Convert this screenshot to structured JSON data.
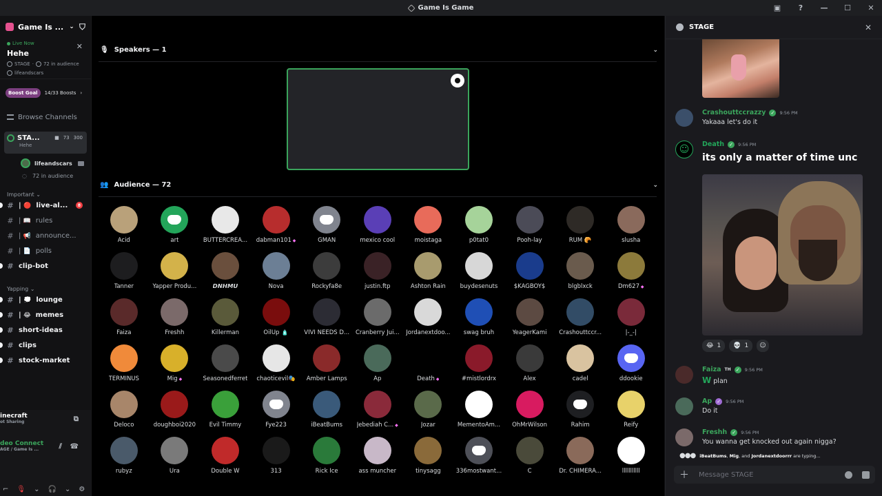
{
  "window": {
    "title": "Game Is Game"
  },
  "sidebar": {
    "server_name": "Game Is ...",
    "live": {
      "badge": "Live Now",
      "title": "Hehe",
      "meta_stage": "STAGE",
      "meta_audience": "72 in audience",
      "host": "lifeandscars"
    },
    "boost": {
      "tag": "Boost Goal",
      "count": "14/33 Boosts"
    },
    "browse": "Browse Channels",
    "stage_channel": {
      "name": "STA...",
      "topic": "Hehe",
      "video_count": "73",
      "limit": "300",
      "speaker": "lifeandscars",
      "audience": "72 in audience"
    },
    "categories": [
      {
        "label": "Important",
        "channels": [
          {
            "name": "live-al...",
            "emoji": "🔴",
            "badge": "8",
            "bright": true
          },
          {
            "name": "rules",
            "emoji": "📖",
            "bright": false
          },
          {
            "name": "announce...",
            "emoji": "📢",
            "bright": false
          },
          {
            "name": "polls",
            "emoji": "📄",
            "bright": false
          },
          {
            "name": "clip-bot",
            "emoji": "",
            "bright": true
          }
        ]
      },
      {
        "label": "Yapping",
        "channels": [
          {
            "name": "lounge",
            "emoji": "💭",
            "bright": true
          },
          {
            "name": "memes",
            "emoji": "😂",
            "bright": true
          },
          {
            "name": "short-ideas",
            "emoji": "",
            "bright": true
          },
          {
            "name": "clips",
            "emoji": "",
            "bright": true
          },
          {
            "name": "stock-market",
            "emoji": "",
            "bright": true
          }
        ]
      }
    ],
    "activity": {
      "game": "inecraft",
      "game_sub": "ot Sharing",
      "voice": "deo Connect",
      "voice_sub": "AGE / Game Is ..."
    }
  },
  "stage": {
    "speakers_header": "Speakers — 1",
    "audience_header": "Audience — 72",
    "audience": [
      {
        "name": "Acid",
        "color": "#b9a17a"
      },
      {
        "name": "art",
        "color": "#23a55a",
        "discord": true
      },
      {
        "name": "BUTTERCREA...",
        "color": "#e8e8e8"
      },
      {
        "name": "dabman101",
        "color": "#b72d2d",
        "boost": true
      },
      {
        "name": "GMAN",
        "color": "#80848e",
        "discord": true
      },
      {
        "name": "mexico cool",
        "color": "#5a3fb6"
      },
      {
        "name": "moistaga",
        "color": "#e86b5a"
      },
      {
        "name": "p0tat0",
        "color": "#a6d39a"
      },
      {
        "name": "Pooh-lay",
        "color": "#4b4b57"
      },
      {
        "name": "RUM 🥐",
        "color": "#2e2a26"
      },
      {
        "name": "slusha",
        "color": "#8a6a5c"
      },
      {
        "name": "Tanner",
        "color": "#1d1d1f"
      },
      {
        "name": "Yapper Produ...",
        "color": "#d3b24a"
      },
      {
        "name": "𝘿𝙉𝙃𝙈𝙐",
        "color": "#6a4f3d"
      },
      {
        "name": "Nova",
        "color": "#6c7f95"
      },
      {
        "name": "Rockyfa8e",
        "color": "#3c3c3c"
      },
      {
        "name": "justin.ftp",
        "color": "#3a2226"
      },
      {
        "name": "Ashton Rain",
        "color": "#a89b6e"
      },
      {
        "name": "buydesenuts",
        "color": "#d7d7d7"
      },
      {
        "name": "$KAGBOY$",
        "color": "#1a3c8c"
      },
      {
        "name": "blgblxck",
        "color": "#6a5b4d"
      },
      {
        "name": "Dm627",
        "color": "#8c7a3b",
        "boost": true
      },
      {
        "name": "Faiza",
        "color": "#5a2a2a"
      },
      {
        "name": "Freshh",
        "color": "#7b6a6a"
      },
      {
        "name": "Killerman",
        "color": "#5a5a3a"
      },
      {
        "name": "OilUp 🧴",
        "color": "#7a0d0d"
      },
      {
        "name": "VIVI NEEDS D...",
        "color": "#2c2c34"
      },
      {
        "name": "Cranberry Jui...",
        "color": "#6b6b6b"
      },
      {
        "name": "Jordanextdoo...",
        "color": "#d9d9d9"
      },
      {
        "name": "swag bruh",
        "color": "#1f4fb5"
      },
      {
        "name": "YeagerKami",
        "color": "#5c4a42"
      },
      {
        "name": "Crashouttccr...",
        "color": "#324c66"
      },
      {
        "name": "|-_-|",
        "color": "#7a2a3a"
      },
      {
        "name": "TERMINUS",
        "color": "#f08a3a"
      },
      {
        "name": "Mig",
        "color": "#d8b02a",
        "boost": true
      },
      {
        "name": "Seasonedferret",
        "color": "#4a4a4a"
      },
      {
        "name": "chaoticevil🎭",
        "color": "#e6e6e6"
      },
      {
        "name": "Amber Lamps",
        "color": "#8a2a2a"
      },
      {
        "name": "Ap",
        "color": "#4a6a5a"
      },
      {
        "name": "Death",
        "color": "#000000",
        "boost": true
      },
      {
        "name": "#mistlordrx",
        "color": "#8a1a2a"
      },
      {
        "name": "Alex",
        "color": "#3a3a3a"
      },
      {
        "name": "cadel",
        "color": "#d9c3a0"
      },
      {
        "name": "ddookie",
        "color": "#5865f2",
        "discord": true
      },
      {
        "name": "Deloco",
        "color": "#a8866a"
      },
      {
        "name": "doughboi2020",
        "color": "#9a1a1a"
      },
      {
        "name": "Evil Timmy",
        "color": "#3aa03a"
      },
      {
        "name": "Fye223",
        "color": "#80848e",
        "discord": true
      },
      {
        "name": "iBeatBums",
        "color": "#3a5a7a"
      },
      {
        "name": "Jebediah C...",
        "color": "#8a2a3a",
        "boost": true
      },
      {
        "name": "Jozar",
        "color": "#5a6a4a"
      },
      {
        "name": "MementoAm...",
        "color": "#ffffff"
      },
      {
        "name": "OhMrWilson",
        "color": "#d81b60"
      },
      {
        "name": "Rahim",
        "color": "#1e1f22",
        "discord": true
      },
      {
        "name": "Reify",
        "color": "#e8d26a"
      },
      {
        "name": "rubyz",
        "color": "#4a5a6a"
      },
      {
        "name": "Ura",
        "color": "#7a7a7a"
      },
      {
        "name": "Double W",
        "color": "#c02a2a"
      },
      {
        "name": "313",
        "color": "#1a1a1a"
      },
      {
        "name": "Rick Ice",
        "color": "#2a7a3a"
      },
      {
        "name": "ass muncher",
        "color": "#c8b8c8"
      },
      {
        "name": "tinysagg",
        "color": "#8a6a3a"
      },
      {
        "name": "336mostwant...",
        "color": "#4e5058",
        "discord": true
      },
      {
        "name": "C",
        "color": "#4a4a3a"
      },
      {
        "name": "Dr. CHIMERA...",
        "color": "#8a6a5a"
      },
      {
        "name": "lllllllllll",
        "color": "#ffffff"
      }
    ]
  },
  "chat": {
    "title": "STAGE",
    "messages": [
      {
        "user": "Crashouttccrazzy",
        "time": "9:56 PM",
        "text": "Yakaaa let's do it",
        "color": "#3ba55c"
      },
      {
        "user": "Death",
        "time": "9:56 PM",
        "text": "its only a matter of time unc",
        "color": "#23a55a"
      },
      {
        "user": "Faiza",
        "tag": "TH",
        "time": "9:56 PM",
        "text": "plan",
        "emoji": "W",
        "color": "#3ba55c"
      },
      {
        "user": "Ap",
        "time": "9:56 PM",
        "text": "Do it",
        "color": "#3ba55c"
      },
      {
        "user": "Freshh",
        "time": "9:56 PM",
        "text": "You wanna get knocked out again nigga?",
        "color": "#3ba55c"
      }
    ],
    "reactions": [
      {
        "emoji": "😂",
        "count": "1"
      },
      {
        "emoji": "💀",
        "count": "1"
      }
    ],
    "typing": {
      "a": "iBeatBums",
      "b": "Mig",
      "c": "Jordanextdoorrr",
      "sep1": ", ",
      "sep2": ", and ",
      "suffix": " are typing..."
    },
    "input_placeholder": "Message STAGE"
  }
}
